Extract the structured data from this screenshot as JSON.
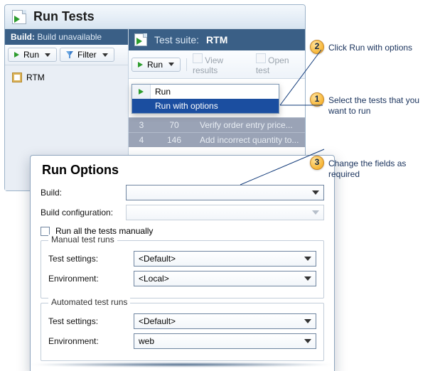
{
  "window": {
    "title": "Run Tests",
    "build_label": "Build:",
    "build_value": "Build unavailable",
    "run_label": "Run",
    "filter_label": "Filter",
    "tree_item": "RTM"
  },
  "pane": {
    "suite_label": "Test suite:",
    "suite_name": "RTM",
    "run_label": "Run",
    "view_results": "View results",
    "open_test": "Open test"
  },
  "menu": {
    "items": [
      {
        "label": "Run"
      },
      {
        "label": "Run with options"
      }
    ],
    "selected_index": 1
  },
  "grid": {
    "rows": [
      {
        "n": "3",
        "id": "70",
        "title": "Verify order entry price..."
      },
      {
        "n": "4",
        "id": "146",
        "title": "Add incorrect quantity to..."
      }
    ]
  },
  "dialog": {
    "title": "Run Options",
    "build_label": "Build:",
    "build_value": "",
    "buildcfg_label": "Build configuration:",
    "buildcfg_value": "",
    "run_all_label": "Run all the tests manually",
    "manual_legend": "Manual test runs",
    "auto_legend": "Automated test runs",
    "settings_label": "Test settings:",
    "env_label": "Environment:",
    "manual": {
      "settings": "<Default>",
      "env": "<Local>"
    },
    "auto": {
      "settings": "<Default>",
      "env": "web"
    }
  },
  "callouts": {
    "c1": {
      "n": "1",
      "text": "Select the tests that you want to run"
    },
    "c2": {
      "n": "2",
      "text": "Click Run with options"
    },
    "c3": {
      "n": "3",
      "text": "Change the fields as required"
    }
  }
}
